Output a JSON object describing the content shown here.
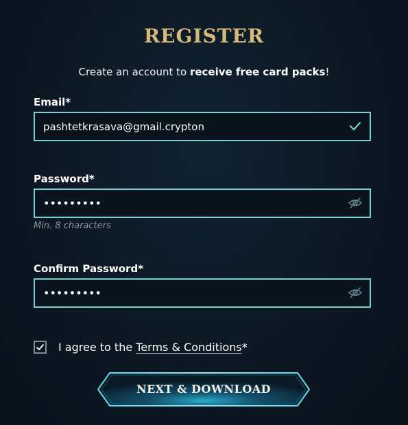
{
  "title": "REGISTER",
  "subtitle": {
    "prefix": "Create an account to ",
    "bold": "receive free card packs",
    "suffix": "!"
  },
  "email": {
    "label": "Email*",
    "value": "pashtetkrasava@gmail.crypton",
    "status_icon": "checkmark-icon"
  },
  "password": {
    "label": "Password*",
    "masked_value": "•••••••••",
    "hint": "Min. 8 characters",
    "toggle_icon": "eye-slash-icon"
  },
  "confirm_password": {
    "label": "Confirm Password*",
    "masked_value": "•••••••••",
    "toggle_icon": "eye-slash-icon"
  },
  "terms": {
    "checked": true,
    "prefix": "I agree to the ",
    "link": "Terms & Conditions",
    "suffix": "*"
  },
  "next_button": {
    "label": "NEXT & DOWNLOAD"
  },
  "colors": {
    "title_gold": "#d4b97a",
    "field_border": "#7ccfd0",
    "background": "#0c1620",
    "button_glow": "#3ec9e6"
  }
}
